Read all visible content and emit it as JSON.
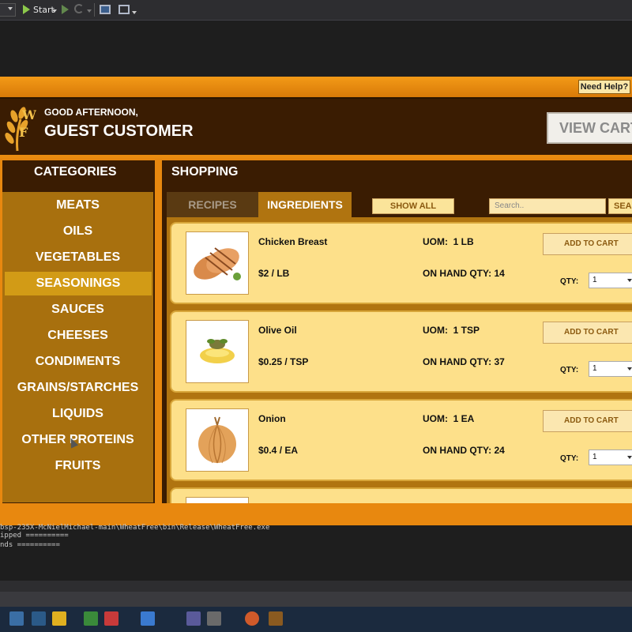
{
  "ide": {
    "start_label": "Start",
    "output_lines": [
      "bsp-235X-McNielMichael-main\\WheatFree\\bin\\Release\\WheatFree.exe",
      "ipped ==========",
      "nds =========="
    ]
  },
  "app": {
    "help_label": "Need Help?",
    "greeting": "GOOD AFTERNOON,",
    "customer_name": "GUEST CUSTOMER",
    "view_cart_label": "VIEW CART",
    "categories_title": "CATEGORIES",
    "categories": [
      "MEATS",
      "OILS",
      "VEGETABLES",
      "SEASONINGS",
      "SAUCES",
      "CHEESES",
      "CONDIMENTS",
      "GRAINS/STARCHES",
      "LIQUIDS",
      "OTHER PROTEINS",
      "FRUITS"
    ],
    "selected_category": "SEASONINGS",
    "shopping_title": "SHOPPING",
    "tabs": {
      "recipes": "RECIPES",
      "ingredients": "INGREDIENTS"
    },
    "active_tab": "INGREDIENTS",
    "show_all_label": "SHOW ALL",
    "search_placeholder": "Search..",
    "search_button_label": "SEARCH",
    "products": [
      {
        "name": "Chicken Breast",
        "price": "$2 / LB",
        "uom": "UOM:  1 LB",
        "on_hand": "ON HAND QTY: 14",
        "add_label": "ADD TO CART",
        "qty_label": "QTY:",
        "qty_value": "1",
        "image_icon": "chicken-breast-image"
      },
      {
        "name": "Olive Oil",
        "price": "$0.25 / TSP",
        "uom": "UOM:  1 TSP",
        "on_hand": "ON HAND QTY: 37",
        "add_label": "ADD TO CART",
        "qty_label": "QTY:",
        "qty_value": "1",
        "image_icon": "olive-oil-image"
      },
      {
        "name": "Onion",
        "price": "$0.4 / EA",
        "uom": "UOM:  1 EA",
        "on_hand": "ON HAND QTY: 24",
        "add_label": "ADD TO CART",
        "qty_label": "QTY:",
        "qty_value": "1",
        "image_icon": "onion-image"
      }
    ]
  },
  "colors": {
    "brand_orange": "#e8880f",
    "panel_brown": "#3a1c02",
    "card_yellow": "#fde08a",
    "selected_category": "#d29b16"
  }
}
